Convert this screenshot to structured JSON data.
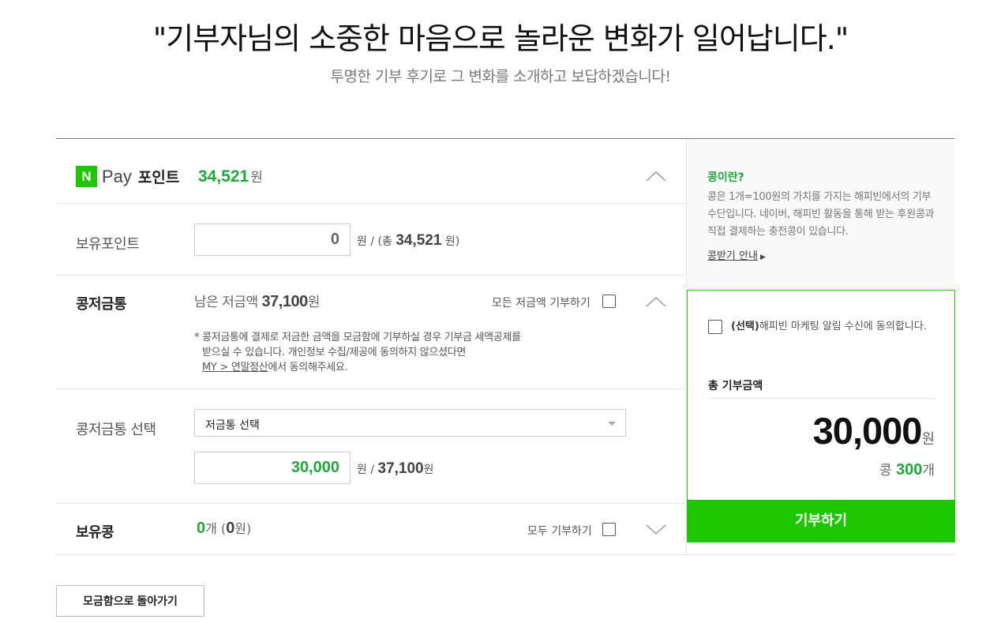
{
  "header": {
    "headline": "\"기부자님의 소중한 마음으로 놀라운 변화가 일어납니다.\"",
    "subline": "투명한 기부 후기로 그 변화를 소개하고 보답하겠습니다!"
  },
  "npay": {
    "logo_letter": "N",
    "pay_label": "Pay",
    "point_label": "포인트",
    "amount": "34,521",
    "amount_unit": "원"
  },
  "held_points": {
    "label": "보유포인트",
    "input_value": "0",
    "unit_prefix": "원 / (총",
    "total": "34,521",
    "unit_suffix": "원)"
  },
  "savings": {
    "label": "콩저금통",
    "remain_prefix": "남은 저금액",
    "remain_amount": "37,100",
    "remain_unit": "원",
    "donate_all_label": "모든 저금액 기부하기",
    "note_line1": "* 콩저금통에 결제로 저금한 금액을 모금함에 기부하실 경우 기부금 세액공제를",
    "note_line2": "받으실 수 있습니다. 개인정보 수집/제공에 동의하지 않으셨다면",
    "note_link": "MY > 연말정산",
    "note_line3_suffix": "에서 동의해주세요."
  },
  "savings_select": {
    "label": "콩저금통 선택",
    "select_value": "저금통 선택",
    "input_value": "30,000",
    "unit_prefix": "원 /",
    "max": "37,100",
    "unit_suffix": "원"
  },
  "held_beans": {
    "label": "보유콩",
    "count": "0",
    "count_unit": "개 (",
    "won": "0",
    "won_unit": "원)",
    "donate_all_label": "모두 기부하기"
  },
  "info": {
    "title": "콩이란?",
    "desc": "콩은 1개=100원의 가치를 가지는 해피빈에서의 기부수단입니다. 네이버, 해피빈 활동을 통해 받는 후원콩과 직접 결제하는 충전콩이 있습니다.",
    "link": "콩받기 안내",
    "link_arrow": "▶"
  },
  "summary": {
    "agree_bold": "(선택)",
    "agree_text": "해피빈 마케팅 알림 수신에 동의합니다.",
    "title": "총 기부금액",
    "amount": "30,000",
    "amount_unit": "원",
    "bean_prefix": "콩",
    "bean_count": "300",
    "bean_unit": "개"
  },
  "donate_button": "기부하기",
  "back_button": "모금함으로 돌아가기",
  "colors": {
    "brand_green": "#1ec800",
    "amount_green": "#1fa83a"
  },
  "icons": {
    "collapse": "chevron-up-icon",
    "expand": "chevron-down-icon"
  }
}
